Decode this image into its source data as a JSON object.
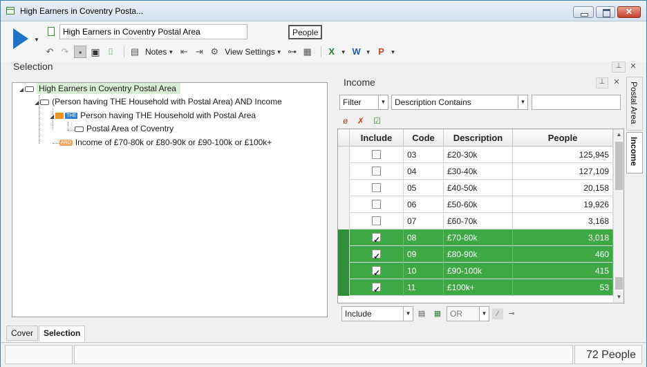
{
  "window": {
    "title": "High Earners in Coventry Posta..."
  },
  "toolbar": {
    "selection_name": "High Earners in Coventry Postal Area",
    "people_label": "People",
    "notes_label": "Notes",
    "view_settings_label": "View Settings"
  },
  "selection_panel": {
    "label": "Selection"
  },
  "tree": {
    "root": "High Earners in Coventry Postal Area",
    "and_node": "(Person having THE Household with Postal Area) AND Income",
    "the_badge": "THE",
    "person_node": "Person having THE Household with Postal Area",
    "postal_node": "Postal Area of Coventry",
    "and_badge": "AND",
    "income_node": "Income of £70-80k or £80-90k or £90-100k or £100k+"
  },
  "income_panel": {
    "title": "Income",
    "filter_label": "Filter",
    "filter_mode": "Description Contains",
    "filter_text": "",
    "columns": [
      "Include",
      "Code",
      "Description",
      "People"
    ],
    "rows": [
      {
        "checked": false,
        "code": "03",
        "description": "£20-30k",
        "people": "125,945"
      },
      {
        "checked": false,
        "code": "04",
        "description": "£30-40k",
        "people": "127,109"
      },
      {
        "checked": false,
        "code": "05",
        "description": "£40-50k",
        "people": "20,158"
      },
      {
        "checked": false,
        "code": "06",
        "description": "£50-60k",
        "people": "19,926"
      },
      {
        "checked": false,
        "code": "07",
        "description": "£60-70k",
        "people": "3,168"
      },
      {
        "checked": true,
        "code": "08",
        "description": "£70-80k",
        "people": "3,018"
      },
      {
        "checked": true,
        "code": "09",
        "description": "£80-90k",
        "people": "460"
      },
      {
        "checked": true,
        "code": "10",
        "description": "£90-100k",
        "people": "415"
      },
      {
        "checked": true,
        "code": "11",
        "description": "£100k+",
        "people": "53"
      }
    ],
    "include_mode": "Include",
    "logic_mode": "OR"
  },
  "side_tabs": [
    "Postal Area",
    "Income"
  ],
  "bottom_tabs": [
    "Cover",
    "Selection"
  ],
  "status": {
    "count": "72 People"
  },
  "colors": {
    "accent": "#1e73c8",
    "selected_row": "#3ea845",
    "root_highlight": "#d9eed7"
  }
}
